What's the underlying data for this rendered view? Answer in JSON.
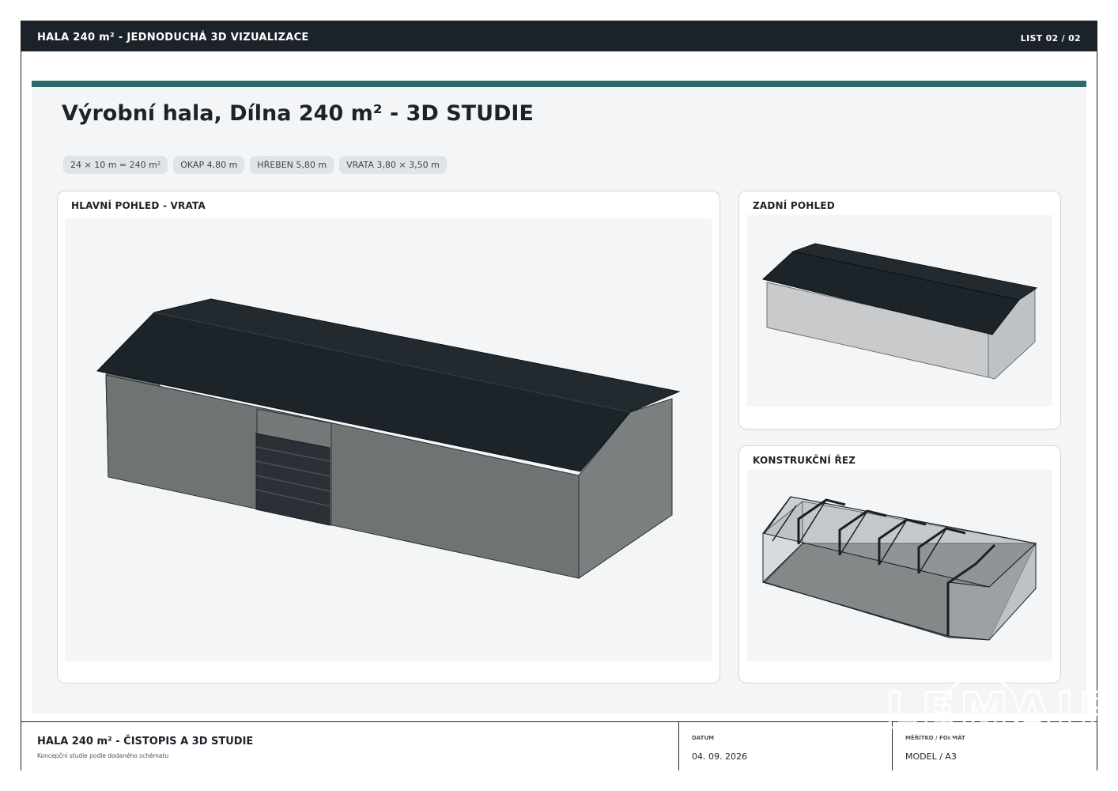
{
  "header": {
    "title": "HALA 240 m² - JEDNODUCHÁ 3D VIZUALIZACE",
    "sheet": "LIST 02 / 02"
  },
  "main": {
    "title": "Výrobní hala, Dílna 240 m² - 3D STUDIE",
    "chips": [
      "24 × 10 m = 240 m²",
      "OKAP 4,80 m",
      "HŘEBEN 5,80 m",
      "VRATA 3,80 × 3,50 m"
    ]
  },
  "views": {
    "main_title": "HLAVNÍ POHLED - VRATA",
    "rear_title": "ZADNÍ POHLED",
    "section_title": "KONSTRUKČNÍ ŘEZ"
  },
  "title_block": {
    "project": "HALA 240 m² - ČISTOPIS A 3D STUDIE",
    "subtitle": "Koncepční studie podle dodaného schématu",
    "date_label": "DATUM",
    "date_value": "04. 09. 2026",
    "scale_label": "MĚŘÍTKO / FORMÁT",
    "scale_value": "MODEL / A3"
  },
  "logo_text": "LEMAIR",
  "colors": {
    "header_bg": "#1b2229",
    "accent": "#2e6b70",
    "panel_bg": "#f3f5f7",
    "roof": "#1c2329",
    "wall_front": "#6f7474",
    "wall_side": "#7a7f7f",
    "rear_wall": "#c8cacc",
    "frame": "#1a1f24"
  }
}
